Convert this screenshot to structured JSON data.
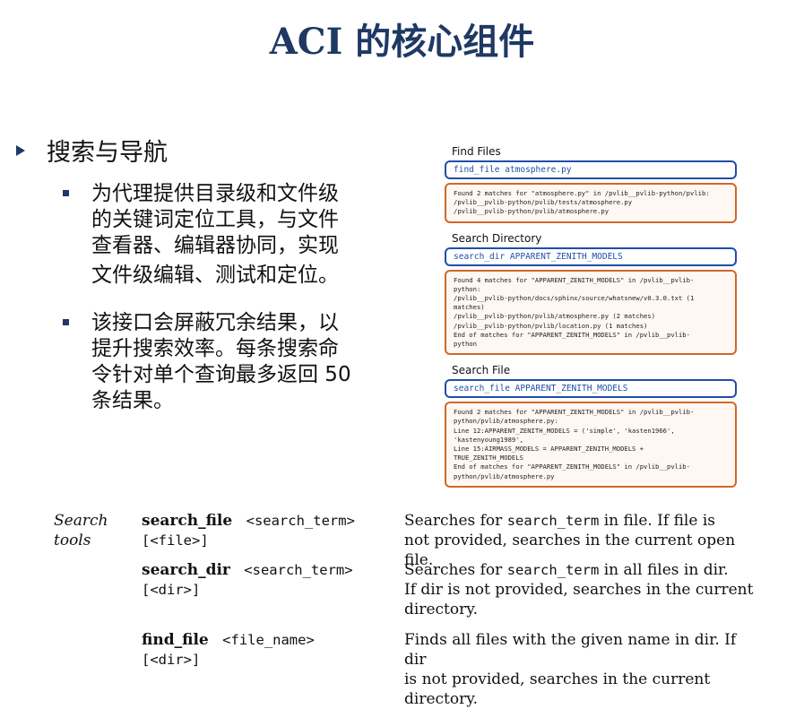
{
  "slide": {
    "title": "ACI 的核心组件",
    "heading": "搜索与导航",
    "points": [
      {
        "lines": [
          "为代理提供目录级和文件级",
          "的关键词定位工具，与文件",
          "查看器、编辑器协同，实现",
          "文件级编辑、测试和定位。"
        ]
      },
      {
        "lines": [
          "该接口会屏蔽冗余结果，以",
          "提升搜索效率。每条搜索命",
          "令针对单个查询最多返回 50",
          "条结果。"
        ]
      }
    ]
  },
  "panel": {
    "sections": [
      {
        "title": "Find Files",
        "command": "find_file atmosphere.py",
        "output": [
          "Found 2 matches for \"atmosphere.py\" in /pvlib__pvlib-python/pvlib:",
          "/pvlib__pvlib-python/pvlib/tests/atmosphere.py",
          "/pvlib__pvlib-python/pvlib/atmosphere.py"
        ]
      },
      {
        "title": "Search Directory",
        "command": "search_dir APPARENT_ZENITH_MODELS",
        "output": [
          "Found 4 matches for \"APPARENT_ZENITH_MODELS\" in /pvlib__pvlib-",
          "python:",
          "/pvlib__pvlib-python/docs/sphinx/source/whatsnew/v0.3.0.txt (1",
          "matches)",
          "/pvlib__pvlib-python/pvlib/atmosphere.py (2 matches)",
          "/pvlib__pvlib-python/pvlib/location.py (1 matches)",
          "End of matches for \"APPARENT_ZENITH_MODELS\" in /pvlib__pvlib-",
          "python"
        ]
      },
      {
        "title": "Search File",
        "command": "search_file APPARENT_ZENITH_MODELS",
        "output": [
          "Found 2 matches for \"APPARENT_ZENITH_MODELS\" in /pvlib__pvlib-",
          "python/pvlib/atmosphere.py:",
          "Line 12:APPARENT_ZENITH_MODELS = ('simple', 'kasten1966',",
          "'kastenyoung1989',",
          "Line 15:AIRMASS_MODELS = APPARENT_ZENITH_MODELS +",
          "TRUE_ZENITH_MODELS",
          "End of matches for \"APPARENT_ZENITH_MODELS\" in /pvlib__pvlib-",
          "python/pvlib/atmosphere.py"
        ]
      }
    ]
  },
  "table": {
    "category": [
      "Search",
      "tools"
    ],
    "rows": [
      {
        "name": "search_file",
        "arg1": "<search_term>",
        "arg2": "[<file>]",
        "desc_pre": "Searches for ",
        "desc_code": "search_term",
        "desc_post": " in file.  If file is",
        "desc_lines": [
          "not provided, searches in the current open file."
        ]
      },
      {
        "name": "search_dir",
        "arg1": "<search_term>",
        "arg2": "[<dir>]",
        "desc_pre": "Searches for ",
        "desc_code": "search_term",
        "desc_post": " in all files in dir.",
        "desc_lines": [
          "If dir is not provided, searches in the current",
          "directory."
        ]
      },
      {
        "name": "find_file",
        "arg1": "<file_name>",
        "arg2": "[<dir>]",
        "desc_pre": "Finds all files with the given name in dir. If dir",
        "desc_code": "",
        "desc_post": "",
        "desc_lines": [
          "is not provided, searches in the current directory."
        ]
      }
    ]
  }
}
